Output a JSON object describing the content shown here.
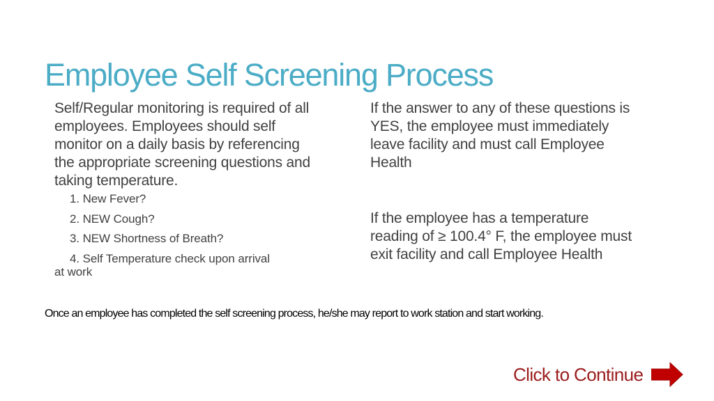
{
  "slide": {
    "title": "Employee Self Screening Process",
    "left_column": {
      "intro": "Self/Regular monitoring is required of all employees. Employees should self monitor on a daily basis by referencing the appropriate screening questions and taking temperature.",
      "questions": [
        {
          "number": "1.",
          "text": "New Fever?"
        },
        {
          "number": "2.",
          "text": "NEW Cough?"
        },
        {
          "number": "3.",
          "text": "NEW Shortness of Breath?"
        },
        {
          "number": "4.",
          "text": "Self Temperature check upon arrival",
          "continuation": "at work"
        }
      ]
    },
    "right_column": {
      "block_1": "If the answer to any of these questions is YES, the employee must immediately leave facility and must call Employee Health",
      "block_2": "If the employee has a temperature reading of ≥ 100.4° F, the employee must exit facility and call Employee Health"
    },
    "footer_note": "Once an employee has completed the self screening process, he/she may report to work station and start working.",
    "continue_button": {
      "label": "Click to Continue",
      "icon": "right-arrow-icon"
    }
  },
  "colors": {
    "title": "#4bacc6",
    "body_text": "#404040",
    "footer_text": "#000000",
    "continue_text": "#9b1c1c",
    "arrow_fill": "#c00000"
  }
}
